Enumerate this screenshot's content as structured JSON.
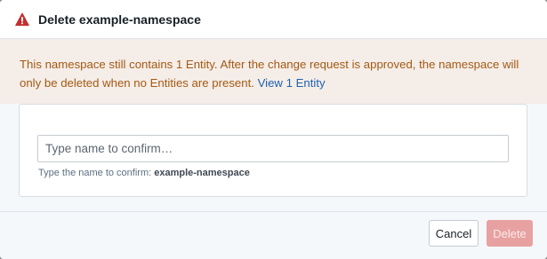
{
  "dialog": {
    "title": "Delete example-namespace",
    "warning_text": "This namespace still contains 1 Entity. After the change request is approved, the namespace will only be deleted when no Entities are present.",
    "warning_link": "View 1 Entity",
    "input_placeholder": "Type name to confirm…",
    "input_value": "",
    "helper_prefix": "Type the name to confirm:",
    "helper_name": "example-namespace",
    "cancel_label": "Cancel",
    "delete_label": "Delete",
    "colors": {
      "warning_icon": "#c23030",
      "warning_text": "#a35a13",
      "link": "#1e62b0",
      "delete_disabled": "#e8a1a1"
    }
  }
}
